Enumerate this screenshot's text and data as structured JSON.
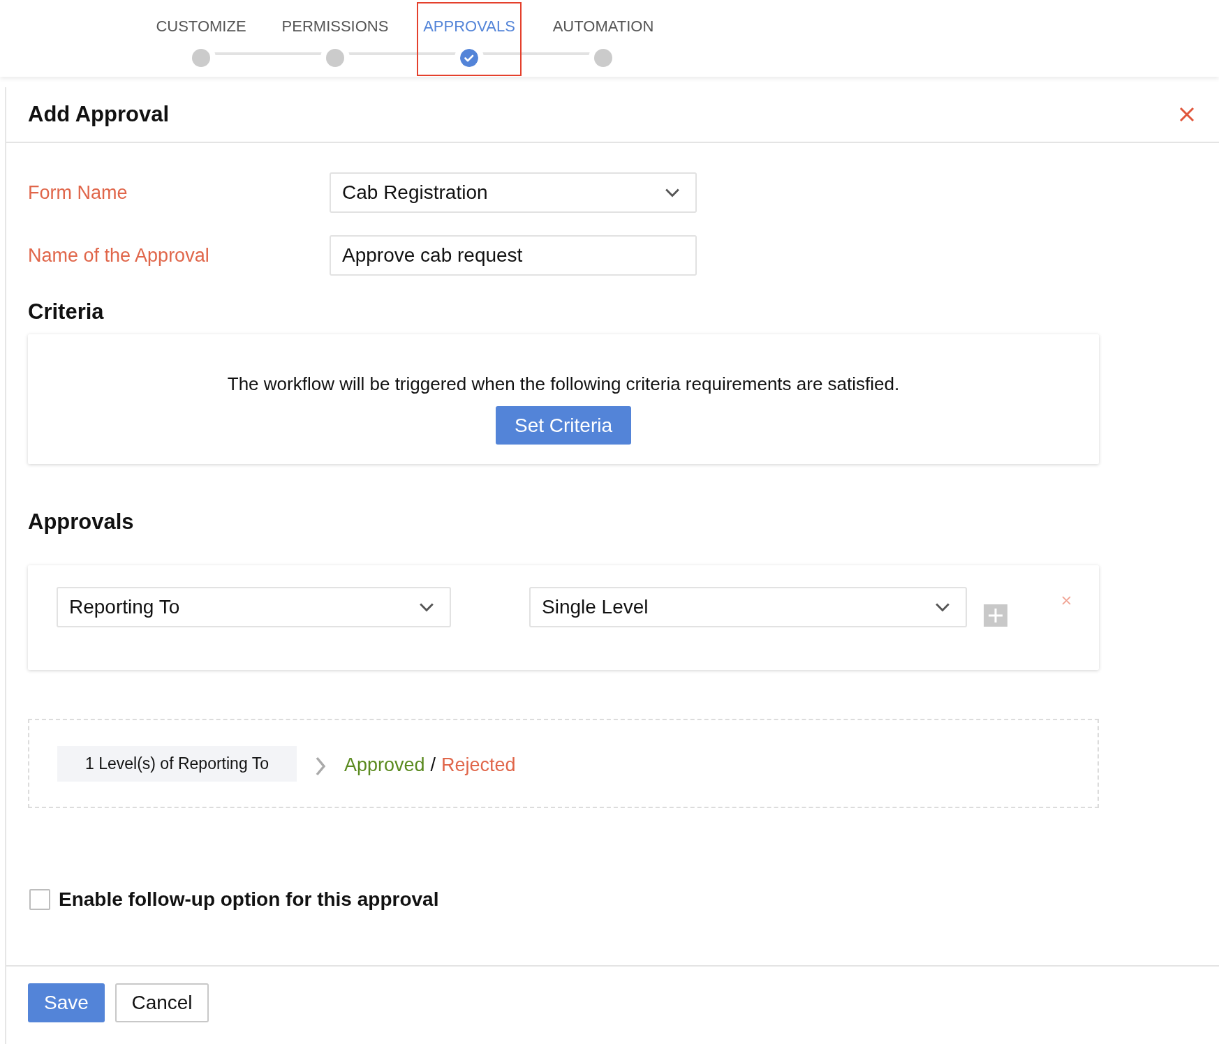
{
  "steps": [
    {
      "label": "CUSTOMIZE",
      "selected": false
    },
    {
      "label": "PERMISSIONS",
      "selected": false
    },
    {
      "label": "APPROVALS",
      "selected": true
    },
    {
      "label": "AUTOMATION",
      "selected": false
    }
  ],
  "panel": {
    "title": "Add Approval"
  },
  "form": [
    {
      "label": "Form Name",
      "kind": "select",
      "value": "Cab Registration"
    },
    {
      "label": "Name of the Approval",
      "kind": "text",
      "value": "Approve cab request"
    }
  ],
  "criteria": {
    "heading": "Criteria",
    "text": "The workflow will be triggered when the following criteria requirements are satisfied.",
    "button": "Set Criteria"
  },
  "approvals": {
    "heading": "Approvals",
    "selects": [
      "Reporting To",
      "Single Level"
    ],
    "summary": {
      "chip": "1 Level(s) of Reporting To",
      "approved": "Approved",
      "separator": "/",
      "rejected": "Rejected"
    }
  },
  "follow_up": {
    "label": "Enable follow-up option for this approval",
    "checked": false
  },
  "buttons": {
    "save": "Save",
    "cancel": "Cancel"
  }
}
